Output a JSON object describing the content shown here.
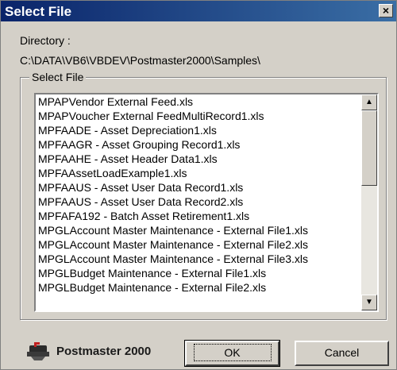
{
  "window": {
    "title": "Select File",
    "close_label": "×"
  },
  "directory": {
    "label": "Directory :",
    "path": "C:\\DATA\\VB6\\VBDEV\\Postmaster2000\\Samples\\"
  },
  "group": {
    "label": "Select File"
  },
  "files": [
    "MPAPVendor External Feed.xls",
    "MPAPVoucher External FeedMultiRecord1.xls",
    "MPFAADE - Asset Depreciation1.xls",
    "MPFAAGR - Asset Grouping Record1.xls",
    "MPFAAHE - Asset Header Data1.xls",
    "MPFAAssetLoadExample1.xls",
    "MPFAAUS - Asset User Data Record1.xls",
    "MPFAAUS - Asset User Data Record2.xls",
    "MPFAFA192 - Batch Asset Retirement1.xls",
    "MPGLAccount Master Maintenance - External File1.xls",
    "MPGLAccount Master Maintenance - External File2.xls",
    "MPGLAccount Master Maintenance - External File3.xls",
    "MPGLBudget Maintenance - External File1.xls",
    "MPGLBudget Maintenance - External File2.xls"
  ],
  "scroll": {
    "position": 0.0,
    "visible_fraction": 0.41
  },
  "logo": {
    "text": "Postmaster 2000",
    "icon": "mailbox-icon"
  },
  "buttons": {
    "ok_label": "OK",
    "cancel_label": "Cancel"
  }
}
